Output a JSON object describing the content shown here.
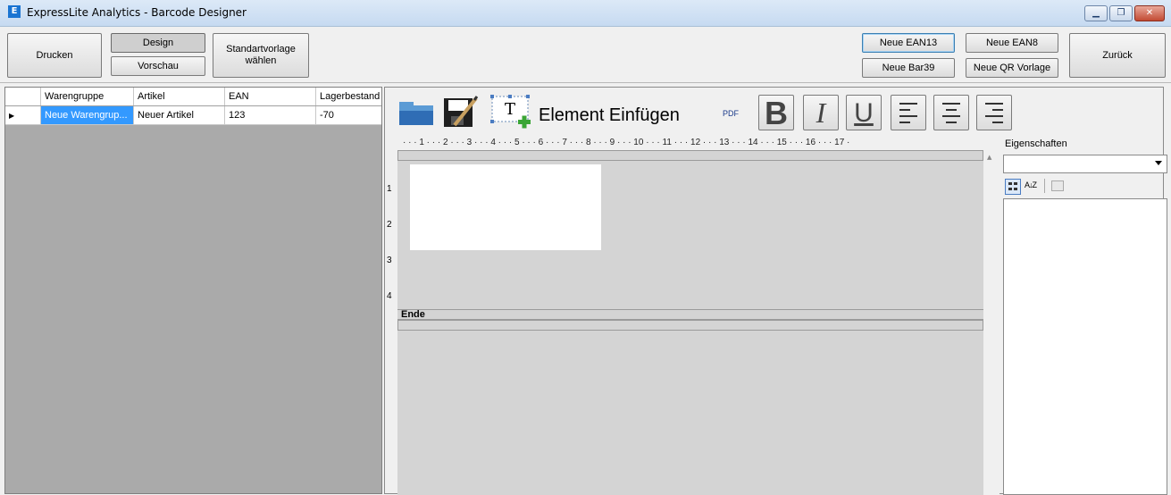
{
  "window": {
    "title": "ExpressLite Analytics - Barcode Designer",
    "app_icon_glyph": "E",
    "min_glyph": "▁",
    "max_glyph": "❐",
    "close_glyph": "✕"
  },
  "toolbar": {
    "print_label": "Drucken",
    "design_label": "Design",
    "preview_label": "Vorschau",
    "template_label_line1": "Standartvorlage",
    "template_label_line2": "wählen",
    "new_ean13_label": "Neue EAN13",
    "new_ean8_label": "Neue EAN8",
    "new_bar39_label": "Neue Bar39",
    "new_qr_label": "Neue QR Vorlage",
    "back_label": "Zurück"
  },
  "grid": {
    "columns": [
      "Warengruppe",
      "Artikel",
      "EAN",
      "Lagerbestand"
    ],
    "rows": [
      {
        "group": "Neue Warengrup...",
        "article": "Neuer Artikel",
        "ean": "123",
        "stock": "-70"
      }
    ],
    "row_indicator": "▶"
  },
  "designer": {
    "insert_element_label": "Element Einfügen",
    "pdf_label": "PDF",
    "bold_glyph": "B",
    "italic_glyph": "I",
    "underline_glyph": "U",
    "ruler_text": "· · · 1 · · · 2 · · · 3 · · · 4 · · · 5 · · · 6 · · · 7 · · · 8 · · · 9 · · · 10 · · · 11 · · · 12 · · · 13 · · · 14 · · · 15 · · · 16 · · · 17 ·",
    "vruler": [
      "1",
      "2",
      "3",
      "4"
    ],
    "end_band_label": "Ende"
  },
  "properties": {
    "title": "Eigenschaften",
    "sort_glyph": "A↓Z"
  }
}
